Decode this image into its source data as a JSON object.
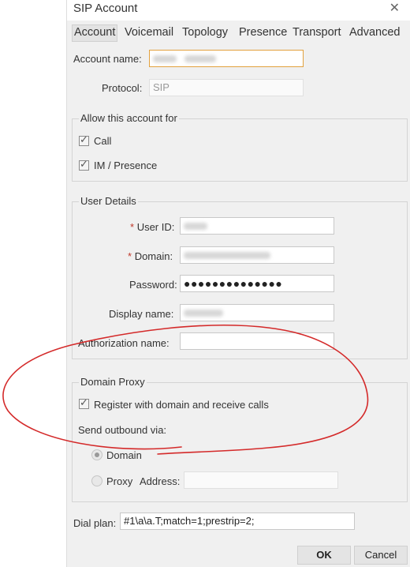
{
  "window": {
    "title": "SIP Account"
  },
  "tabs": [
    {
      "label": "Account",
      "active": true
    },
    {
      "label": "Voicemail"
    },
    {
      "label": "Topology"
    },
    {
      "label": "Presence"
    },
    {
      "label": "Transport"
    },
    {
      "label": "Advanced"
    }
  ],
  "account": {
    "name_label": "Account name:",
    "protocol_label": "Protocol:",
    "protocol_value": "SIP"
  },
  "allow": {
    "legend": "Allow this account for",
    "call_label": "Call",
    "call_checked": true,
    "im_label": "IM / Presence",
    "im_checked": true
  },
  "user_details": {
    "legend": "User Details",
    "required_mark": "*",
    "user_id_label": "User ID:",
    "domain_label": "Domain:",
    "password_label": "Password:",
    "password_value": "●●●●●●●●●●●●●●",
    "display_name_label": "Display name:",
    "auth_name_label": "Authorization name:"
  },
  "domain_proxy": {
    "legend": "Domain Proxy",
    "register_label": "Register with domain and receive calls",
    "register_checked": true,
    "send_outbound_label": "Send outbound via:",
    "domain_option": "Domain",
    "proxy_option": "Proxy",
    "address_label": "Address:"
  },
  "dial_plan": {
    "label": "Dial plan:",
    "value": "#1\\a\\a.T;match=1;prestrip=2;"
  },
  "buttons": {
    "ok": "OK",
    "cancel": "Cancel"
  },
  "colors": {
    "annotation": "#d42a2a",
    "focus_border": "#e2a13e"
  }
}
